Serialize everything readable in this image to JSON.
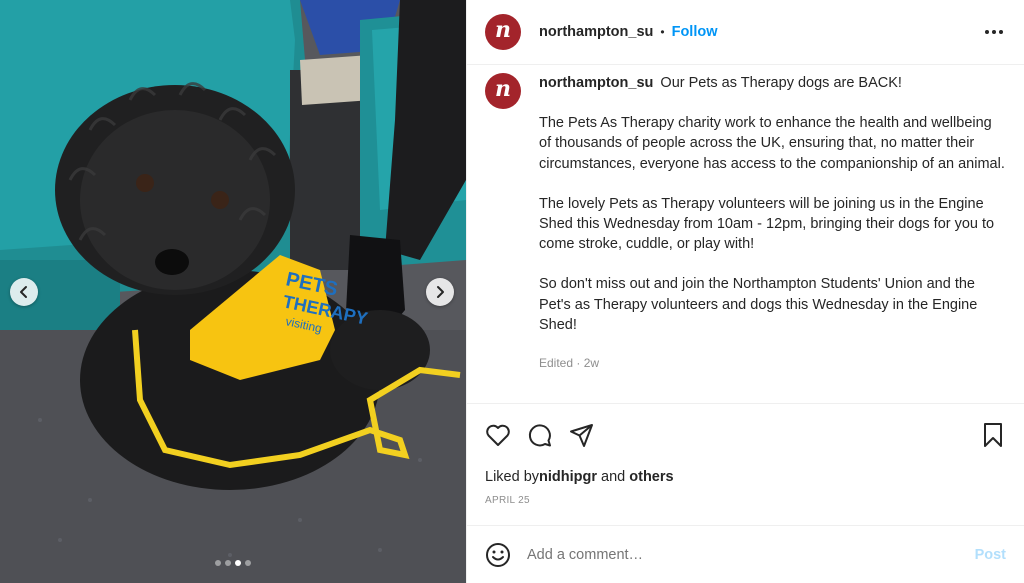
{
  "post": {
    "username": "northampton_su",
    "avatar_letter": "n",
    "separator": "•",
    "follow_label": "Follow",
    "caption_paragraphs": [
      "Our Pets as Therapy dogs are BACK!",
      "The Pets As Therapy charity work to enhance the health and wellbeing of thousands of people across the UK, ensuring that, no matter their circumstances, everyone has access to the companionship of an animal.",
      "The lovely Pets as Therapy volunteers will be joining us in the Engine Shed this Wednesday from 10am - 12pm, bringing their dogs for you to come stroke, cuddle, or play with!",
      "So don't miss out and join the Northampton Students' Union and the Pet's as Therapy volunteers and dogs this Wednesday in the Engine Shed!"
    ],
    "edited_label": "Edited · 2w",
    "likes_prefix": "Liked by ",
    "liked_by_user": "nidhipgr",
    "likes_and": " and ",
    "likes_others": "others",
    "date": "APRIL 25",
    "comment_placeholder": "Add a comment…",
    "post_label": "Post"
  },
  "photo": {
    "vest_text_line1": "PETS",
    "vest_text_line2": "THERAPY",
    "vest_text_line3": "visiting",
    "carousel_count": 4,
    "carousel_active_index": 2
  },
  "icons": {
    "more": "more-horizontal-icon",
    "like": "heart-icon",
    "comment": "comment-icon",
    "share": "send-icon",
    "save": "bookmark-icon",
    "emoji": "smiley-icon",
    "prev": "chevron-left-icon",
    "next": "chevron-right-icon"
  },
  "colors": {
    "brand_red": "#a3242b",
    "follow_blue": "#0095f6",
    "post_disabled": "#b2dffc",
    "vest_yellow": "#f7c411"
  }
}
